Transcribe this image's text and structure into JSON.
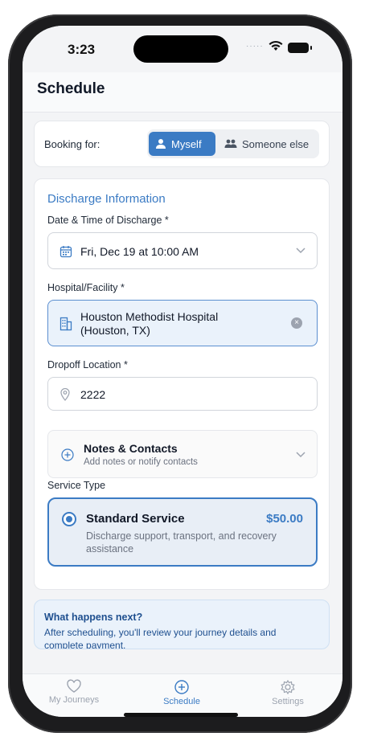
{
  "status_bar": {
    "time": "3:23"
  },
  "header": {
    "title": "Schedule"
  },
  "booking": {
    "label": "Booking for:",
    "options": [
      {
        "label": "Myself",
        "icon": "person-icon",
        "selected": true
      },
      {
        "label": "Someone else",
        "icon": "people-icon",
        "selected": false
      }
    ]
  },
  "discharge": {
    "section_title": "Discharge Information",
    "datetime_label": "Date & Time of Discharge *",
    "datetime_value": "Fri, Dec 19 at 10:00 AM",
    "hospital_label": "Hospital/Facility *",
    "hospital_value_line1": "Houston Methodist Hospital",
    "hospital_value_line2": "(Houston, TX)",
    "dropoff_label": "Dropoff Location *",
    "dropoff_value": "2222",
    "notes_title": "Notes & Contacts",
    "notes_subtitle": "Add notes or notify contacts",
    "service_label": "Service Type",
    "service_name": "Standard Service",
    "service_price": "$50.00",
    "service_description": "Discharge support, transport, and recovery assistance"
  },
  "info": {
    "title": "What happens next?",
    "text": "After scheduling, you'll review your journey details and complete payment."
  },
  "tabs": [
    {
      "label": "My Journeys",
      "icon": "heart-icon",
      "active": false
    },
    {
      "label": "Schedule",
      "icon": "plus-circle-icon",
      "active": true
    },
    {
      "label": "Settings",
      "icon": "gear-icon",
      "active": false
    }
  ],
  "colors": {
    "accent": "#3b7bc4",
    "accent_light": "#eaf2fb",
    "background": "#f3f4f6"
  }
}
